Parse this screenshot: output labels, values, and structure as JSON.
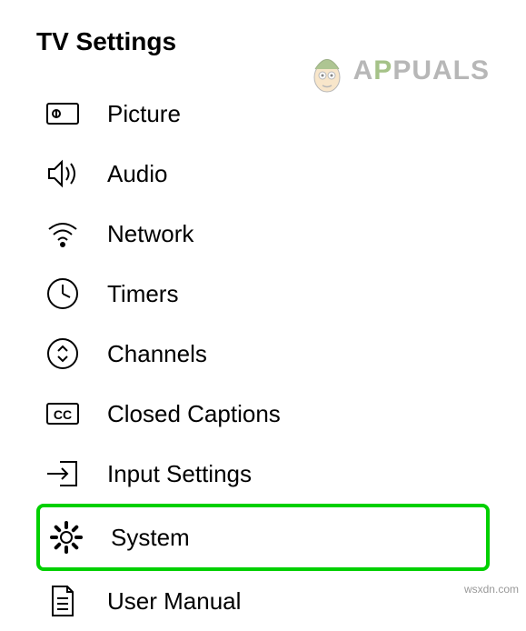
{
  "title": "TV Settings",
  "watermark": {
    "prefix": "A",
    "suffix": "PUALS"
  },
  "menu": {
    "items": [
      {
        "label": "Picture",
        "icon": "picture-icon",
        "highlighted": false
      },
      {
        "label": "Audio",
        "icon": "audio-icon",
        "highlighted": false
      },
      {
        "label": "Network",
        "icon": "network-icon",
        "highlighted": false
      },
      {
        "label": "Timers",
        "icon": "timers-icon",
        "highlighted": false
      },
      {
        "label": "Channels",
        "icon": "channels-icon",
        "highlighted": false
      },
      {
        "label": "Closed Captions",
        "icon": "cc-icon",
        "highlighted": false
      },
      {
        "label": "Input Settings",
        "icon": "input-icon",
        "highlighted": false
      },
      {
        "label": "System",
        "icon": "system-icon",
        "highlighted": true
      },
      {
        "label": "User Manual",
        "icon": "manual-icon",
        "highlighted": false
      }
    ]
  },
  "footer": "wsxdn.com"
}
